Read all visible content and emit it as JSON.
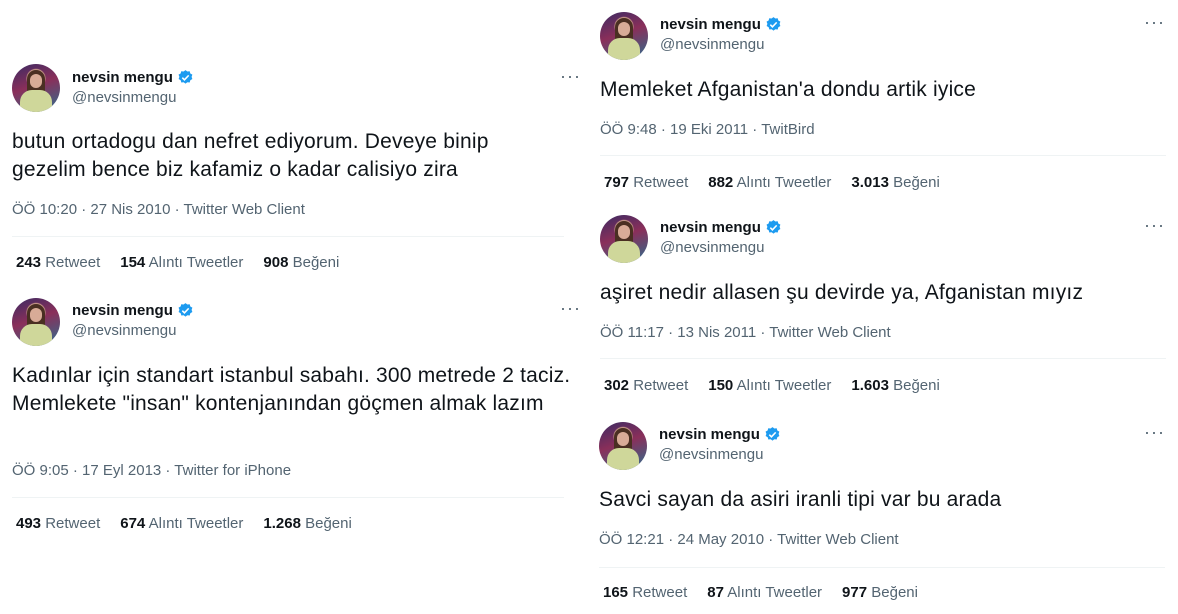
{
  "colors": {
    "verified": "#1d9bf0",
    "muted": "#536471",
    "text": "#0f1419"
  },
  "icons": {
    "verified": "verified-badge-icon",
    "more": "more-options-icon"
  },
  "tweets": [
    {
      "name": "nevsin mengu",
      "handle": "@nevsinmengu",
      "more": "···",
      "text": "butun ortadogu dan nefret ediyorum. Deveye binip gezelim bence biz kafamiz o kadar calisiyo zira",
      "meta": "ÖÖ 10:20 · 27 Nis 2010 · Twitter Web Client",
      "retweets": "243",
      "retweets_label": "Retweet",
      "quotes": "154",
      "quotes_label": "Alıntı Tweetler",
      "likes": "908",
      "likes_label": "Beğeni"
    },
    {
      "name": "nevsin mengu",
      "handle": "@nevsinmengu",
      "more": "···",
      "text": "Kadınlar için standart istanbul sabahı. 300 metrede 2 taciz. Memlekete \"insan\" kontenjanından göçmen almak lazım",
      "meta": "ÖÖ 9:05 · 17 Eyl 2013 · Twitter for iPhone",
      "retweets": "493",
      "retweets_label": "Retweet",
      "quotes": "674",
      "quotes_label": "Alıntı Tweetler",
      "likes": "1.268",
      "likes_label": "Beğeni"
    },
    {
      "name": "nevsin mengu",
      "handle": "@nevsinmengu",
      "more": "···",
      "text": "Memleket Afganistan'a dondu artik iyice",
      "meta": "ÖÖ 9:48 · 19 Eki 2011 · TwitBird",
      "retweets": "797",
      "retweets_label": "Retweet",
      "quotes": "882",
      "quotes_label": "Alıntı Tweetler",
      "likes": "3.013",
      "likes_label": "Beğeni"
    },
    {
      "name": "nevsin mengu",
      "handle": "@nevsinmengu",
      "more": "···",
      "text": "aşiret nedir allasen şu devirde ya, Afganistan mıyız",
      "meta": "ÖÖ 11:17 · 13 Nis 2011 · Twitter Web Client",
      "retweets": "302",
      "retweets_label": "Retweet",
      "quotes": "150",
      "quotes_label": "Alıntı Tweetler",
      "likes": "1.603",
      "likes_label": "Beğeni"
    },
    {
      "name": "nevsin mengu",
      "handle": "@nevsinmengu",
      "more": "···",
      "text": "Savci sayan da asiri iranli tipi var bu arada",
      "meta": "ÖÖ 12:21 · 24 May 2010 · Twitter Web Client",
      "retweets": "165",
      "retweets_label": "Retweet",
      "quotes": "87",
      "quotes_label": "Alıntı Tweetler",
      "likes": "977",
      "likes_label": "Beğeni"
    }
  ]
}
